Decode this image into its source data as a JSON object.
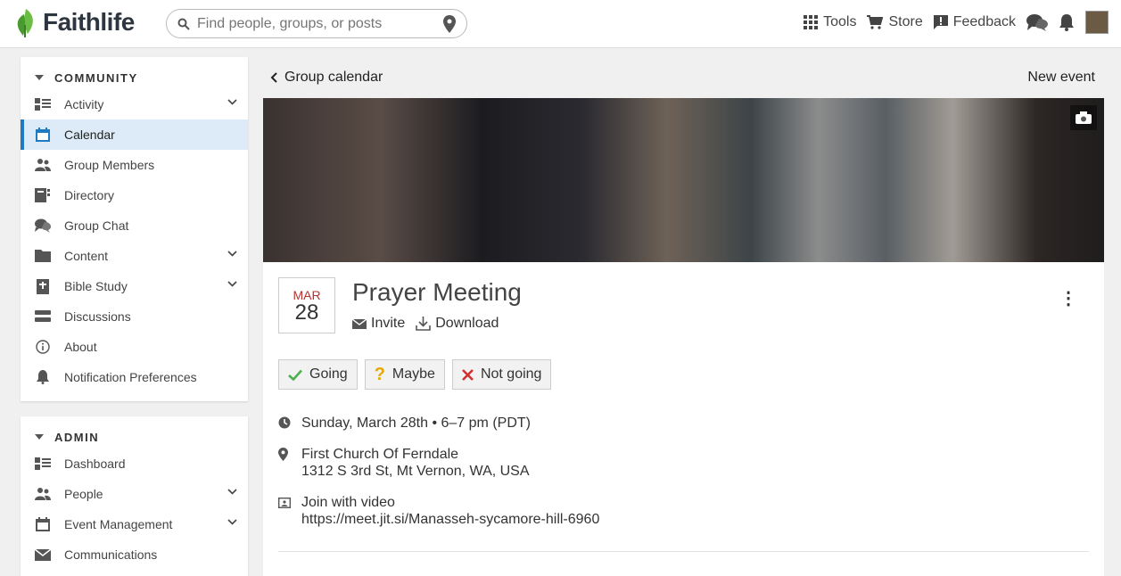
{
  "header": {
    "logo_text": "Faithlife",
    "search_placeholder": "Find people, groups, or posts",
    "tools": "Tools",
    "store": "Store",
    "feedback": "Feedback",
    "brand_color": "#6cbd45"
  },
  "sidebar": {
    "community_title": "COMMUNITY",
    "community_items": [
      {
        "label": "Activity",
        "icon": "activity-icon",
        "chevron": true
      },
      {
        "label": "Calendar",
        "icon": "calendar-icon",
        "active": true
      },
      {
        "label": "Group Members",
        "icon": "members-icon"
      },
      {
        "label": "Directory",
        "icon": "directory-icon"
      },
      {
        "label": "Group Chat",
        "icon": "chat-icon"
      },
      {
        "label": "Content",
        "icon": "folder-icon",
        "chevron": true
      },
      {
        "label": "Bible Study",
        "icon": "bible-icon",
        "chevron": true
      },
      {
        "label": "Discussions",
        "icon": "discussions-icon"
      },
      {
        "label": "About",
        "icon": "info-icon"
      },
      {
        "label": "Notification Preferences",
        "icon": "bell-icon"
      }
    ],
    "admin_title": "ADMIN",
    "admin_items": [
      {
        "label": "Dashboard",
        "icon": "dashboard-icon"
      },
      {
        "label": "People",
        "icon": "people-icon",
        "chevron": true
      },
      {
        "label": "Event Management",
        "icon": "calendar-icon",
        "chevron": true
      },
      {
        "label": "Communications",
        "icon": "envelope-icon"
      }
    ]
  },
  "main": {
    "back_label": "Group calendar",
    "new_event_label": "New event"
  },
  "event": {
    "month": "MAR",
    "day": "28",
    "title": "Prayer Meeting",
    "invite_label": "Invite",
    "download_label": "Download",
    "rsvp": {
      "going": "Going",
      "maybe": "Maybe",
      "not_going": "Not going"
    },
    "datetime": "Sunday, March 28th • 6–7 pm (PDT)",
    "location_name": "First Church Of Ferndale",
    "location_address": "1312 S 3rd St, Mt Vernon, WA, USA",
    "video_label": "Join with video",
    "video_url": "https://meet.jit.si/Manasseh-sycamore-hill-6960"
  },
  "colors": {
    "accent": "#1e7bc1",
    "active_bg": "#dcebf7",
    "going": "#4caf50",
    "maybe": "#e6a800",
    "not_going": "#d32f2f"
  }
}
